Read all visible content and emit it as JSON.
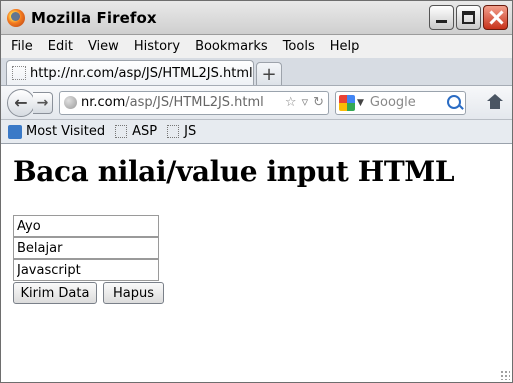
{
  "window": {
    "title": "Mozilla Firefox"
  },
  "menu": [
    "File",
    "Edit",
    "View",
    "History",
    "Bookmarks",
    "Tools",
    "Help"
  ],
  "tab": {
    "label": "http://nr.com/asp/JS/HTML2JS.html"
  },
  "address": {
    "host": "nr.com",
    "path": "/asp/JS/HTML2JS.html"
  },
  "search": {
    "placeholder": "Google"
  },
  "bookmarks": {
    "most_visited": "Most Visited",
    "items": [
      "ASP",
      "JS"
    ]
  },
  "page": {
    "heading": "Baca nilai/value input HTML",
    "inputs": [
      "Ayo",
      "Belajar",
      "Javascript"
    ],
    "buttons": {
      "submit": "Kirim Data",
      "clear": "Hapus"
    }
  },
  "icons": [
    "firefox-logo-icon",
    "minimize-icon",
    "maximize-icon",
    "close-icon",
    "back-icon",
    "forward-icon",
    "globe-icon",
    "star-icon",
    "dropdown-icon",
    "reload-icon",
    "google-icon",
    "search-icon",
    "home-icon",
    "page-icon"
  ]
}
